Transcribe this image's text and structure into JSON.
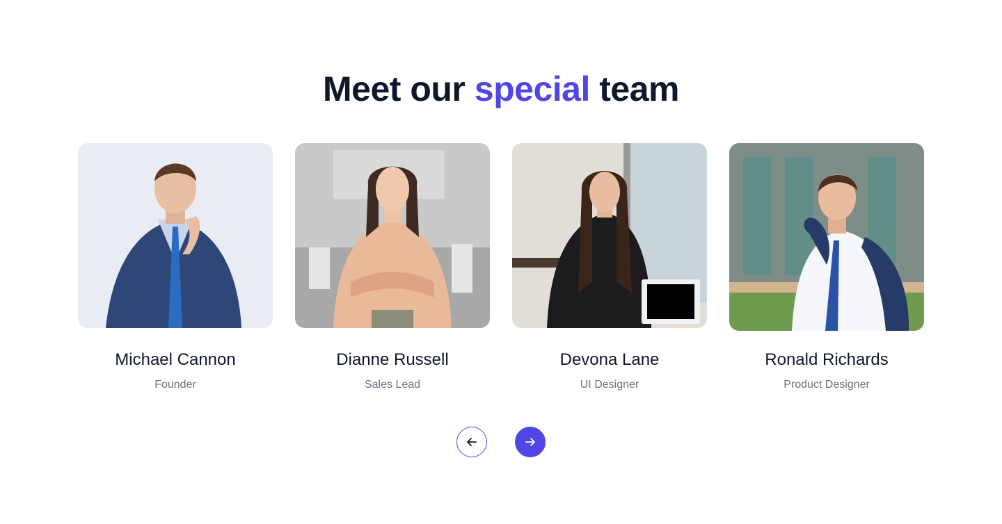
{
  "section": {
    "title_before": "Meet our",
    "title_accent": "special",
    "title_after": "team",
    "accent_color": "#4f46e5"
  },
  "team": [
    {
      "name": "Michael Cannon",
      "role": "Founder"
    },
    {
      "name": "Dianne Russell",
      "role": "Sales Lead"
    },
    {
      "name": "Devona Lane",
      "role": "UI Designer"
    },
    {
      "name": "Ronald Richards",
      "role": "Product Designer"
    }
  ],
  "controls": {
    "prev_icon": "arrow-left-icon",
    "next_icon": "arrow-right-icon"
  }
}
